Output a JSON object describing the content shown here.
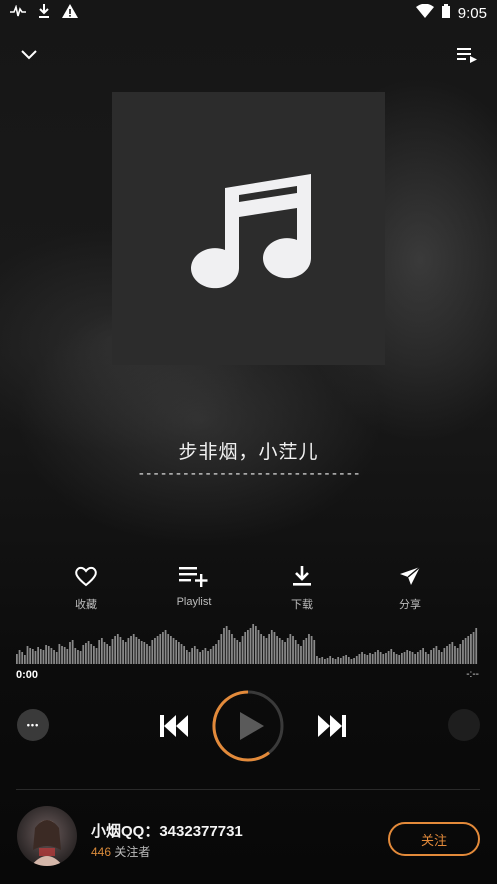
{
  "status_bar": {
    "time": "9:05",
    "icons": [
      "pulse-icon",
      "download-icon",
      "warning-icon",
      "wifi-icon",
      "battery-icon"
    ]
  },
  "top_bar": {
    "collapse_icon": "chevron-down-icon",
    "queue_icon": "queue-music-icon"
  },
  "album_art": {
    "icon": "music-note-icon"
  },
  "song": {
    "title": "步非烟，小茳儿",
    "subtitle": "------------------------------"
  },
  "actions": [
    {
      "label": "收藏",
      "icon": "heart-icon"
    },
    {
      "label": "Playlist",
      "icon": "playlist-add-icon"
    },
    {
      "label": "下载",
      "icon": "download-icon"
    },
    {
      "label": "分享",
      "icon": "share-icon"
    }
  ],
  "progress": {
    "current_time": "0:00",
    "end_time": "-:--",
    "fraction": 0.72,
    "waveform": [
      10,
      14,
      12,
      9,
      18,
      16,
      15,
      13,
      17,
      15,
      14,
      19,
      18,
      16,
      14,
      12,
      20,
      18,
      17,
      15,
      22,
      24,
      16,
      14,
      13,
      19,
      21,
      23,
      20,
      18,
      16,
      24,
      26,
      22,
      20,
      18,
      25,
      28,
      30,
      27,
      24,
      22,
      26,
      28,
      30,
      27,
      25,
      23,
      22,
      20,
      18,
      24,
      26,
      28,
      30,
      32,
      34,
      30,
      28,
      26,
      24,
      22,
      20,
      18,
      14,
      12,
      16,
      18,
      15,
      12,
      14,
      16,
      13,
      15,
      18,
      20,
      24,
      30,
      36,
      38,
      34,
      30,
      26,
      24,
      22,
      28,
      32,
      34,
      36,
      40,
      38,
      34,
      30,
      28,
      26,
      30,
      34,
      32,
      28,
      26,
      24,
      22,
      26,
      30,
      28,
      24,
      20,
      18,
      24,
      26,
      30,
      28,
      24,
      8,
      6,
      7,
      5,
      6,
      8,
      6,
      5,
      7,
      6,
      8,
      9,
      7,
      5,
      6,
      8,
      10,
      12,
      10,
      9,
      11,
      10,
      12,
      14,
      12,
      10,
      11,
      13,
      15,
      12,
      10,
      9,
      11,
      12,
      14,
      13,
      12,
      10,
      12,
      14,
      16,
      12,
      10,
      14,
      16,
      18,
      14,
      12,
      16,
      18,
      20,
      22,
      18,
      16,
      20,
      24,
      26,
      28,
      30,
      32,
      36
    ]
  },
  "controls": {
    "more_label": "•••",
    "prev_icon": "skip-previous-icon",
    "play_icon": "play-icon",
    "next_icon": "skip-next-icon"
  },
  "profile": {
    "name": "小烟QQ：3432377731",
    "followers_count": "446",
    "followers_label": "关注者",
    "follow_label": "关注"
  },
  "colors": {
    "accent": "#e38a3a",
    "background": "#101010",
    "album_bg": "#2c2c2c"
  }
}
